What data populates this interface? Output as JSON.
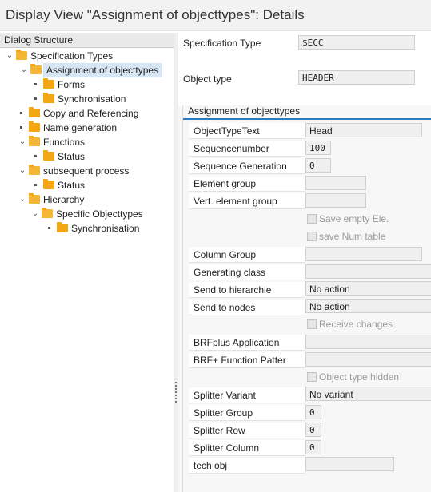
{
  "window": {
    "title": "Display View \"Assignment of objecttypes\": Details"
  },
  "dialog_structure": {
    "header": "Dialog Structure",
    "nodes": [
      {
        "label": "Specification Types"
      },
      {
        "label": "Assignment of objecttypes",
        "selected": true
      },
      {
        "label": "Forms"
      },
      {
        "label": "Synchronisation"
      },
      {
        "label": "Copy and Referencing"
      },
      {
        "label": "Name generation"
      },
      {
        "label": "Functions"
      },
      {
        "label": "Status"
      },
      {
        "label": "subsequent process"
      },
      {
        "label": "Status"
      },
      {
        "label": "Hierarchy"
      },
      {
        "label": "Specific Objecttypes"
      },
      {
        "label": "Synchronisation"
      }
    ]
  },
  "header_fields": {
    "spec_type_label": "Specification Type",
    "spec_type_value": "$ECC",
    "object_type_label": "Object type",
    "object_type_value": "HEADER"
  },
  "group": {
    "title": "Assignment of objecttypes",
    "object_type_text_label": "ObjectTypeText",
    "object_type_text_value": "Head",
    "sequencenumber_label": "Sequencenumber",
    "sequencenumber_value": "100",
    "sequence_generation_label": "Sequence Generation",
    "sequence_generation_value": "0",
    "element_group_label": "Element group",
    "element_group_value": "",
    "vert_element_group_label": "Vert. element group",
    "vert_element_group_value": "",
    "save_empty_label": "Save empty Ele.",
    "save_num_table_label": "save Num table",
    "column_group_label": "Column Group",
    "column_group_value": "",
    "generating_class_label": "Generating class",
    "generating_class_value": "",
    "send_to_hierarchie_label": "Send to hierarchie",
    "send_to_hierarchie_value": "No action",
    "send_to_nodes_label": "Send to nodes",
    "send_to_nodes_value": "No action",
    "receive_changes_label": "Receive changes",
    "brfplus_app_label": "BRFplus Application",
    "brfplus_app_value": "",
    "brf_function_label": "BRF+ Function Patter",
    "brf_function_value": "",
    "object_type_hidden_label": "Object type hidden",
    "splitter_variant_label": "Splitter Variant",
    "splitter_variant_value": "No variant",
    "splitter_group_label": "Splitter Group",
    "splitter_group_value": "0",
    "splitter_row_label": "Splitter Row",
    "splitter_row_value": "0",
    "splitter_column_label": "Splitter Column",
    "splitter_column_value": "0",
    "tech_obj_label": "tech obj",
    "tech_obj_value": ""
  }
}
